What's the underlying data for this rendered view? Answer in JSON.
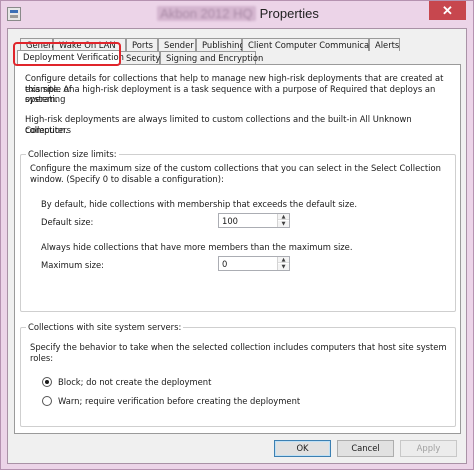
{
  "window": {
    "title_redacted": "Akbon 2012 HQ",
    "title": "Properties",
    "close_glyph": "✕",
    "icon": "properties-window-icon"
  },
  "tabs_row1": [
    "General",
    "Wake On LAN",
    "Ports",
    "Sender",
    "Publishing",
    "Client Computer Communication",
    "Alerts"
  ],
  "tabs_row2": [
    "Deployment Verification",
    "Security",
    "Signing and Encryption"
  ],
  "active_tab": "Deployment Verification",
  "highlight_color": "#e0252b",
  "panel": {
    "intro_line1": "Configure details for collections that help to manage new high-risk deployments that are created at this site. An",
    "intro_line2": "example of a high-risk deployment is a task sequence with a purpose of Required that deploys an operating",
    "intro_line3": "system.",
    "limit_line1": "High-risk deployments are always limited to custom collections and the built-in All Unknown Computers",
    "limit_line2": "collection.",
    "size_limits": {
      "legend": "Collection size limits:",
      "desc_line1": "Configure the maximum size of the custom collections that you can select in the Select Collection",
      "desc_line2": "window. (Specify 0 to disable a configuration):",
      "default_hint": "By default, hide collections with membership that exceeds the default size.",
      "default_label": "Default size:",
      "default_value": "100",
      "always_hint": "Always hide collections that have more members than the maximum size.",
      "maximum_label": "Maximum size:",
      "maximum_value": "0"
    },
    "site_servers": {
      "legend": "Collections with site system servers:",
      "desc_line1": "Specify the behavior to take when the selected collection includes computers that host site system",
      "desc_line2": "roles:",
      "option_block": "Block; do not create the deployment",
      "option_warn": "Warn; require verification before creating the deployment",
      "selected": "block"
    }
  },
  "buttons": {
    "ok": "OK",
    "cancel": "Cancel",
    "apply": "Apply"
  }
}
